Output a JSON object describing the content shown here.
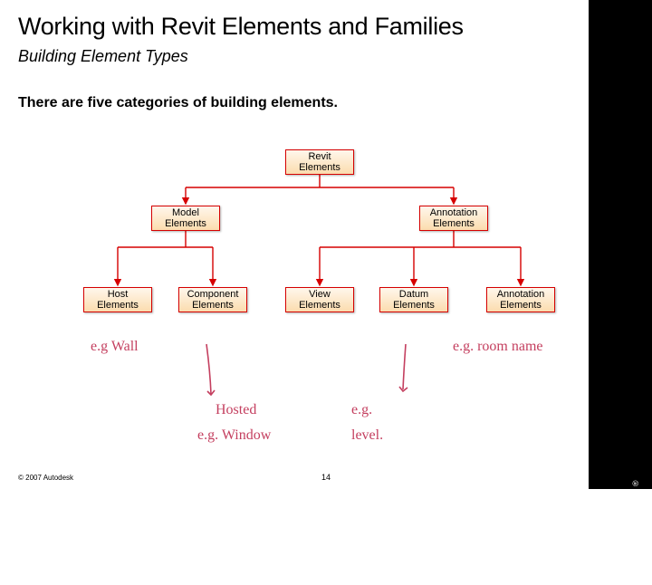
{
  "title": "Working with Revit Elements and Families",
  "subtitle": "Building Element Types",
  "body": "There are five categories of building elements.",
  "footer": "© 2007 Autodesk",
  "page": "14",
  "brand": "Autodesk",
  "nodes": {
    "root": "Revit Elements",
    "mid_left": "Model Elements",
    "mid_right": "Annotation Elements",
    "leaf1": "Host Elements",
    "leaf2": "Component Elements",
    "leaf3": "View Elements",
    "leaf4": "Datum Elements",
    "leaf5": "Annotation Elements"
  },
  "annotations": {
    "a1": "e.g Wall",
    "a2_l1": "Hosted",
    "a2_l2": "e.g. Window",
    "a3_l1": "e.g.",
    "a3_l2": "level.",
    "a4": "e.g. room name"
  },
  "colors": {
    "connector": "#d60000",
    "handwriting": "#c43f5f"
  }
}
